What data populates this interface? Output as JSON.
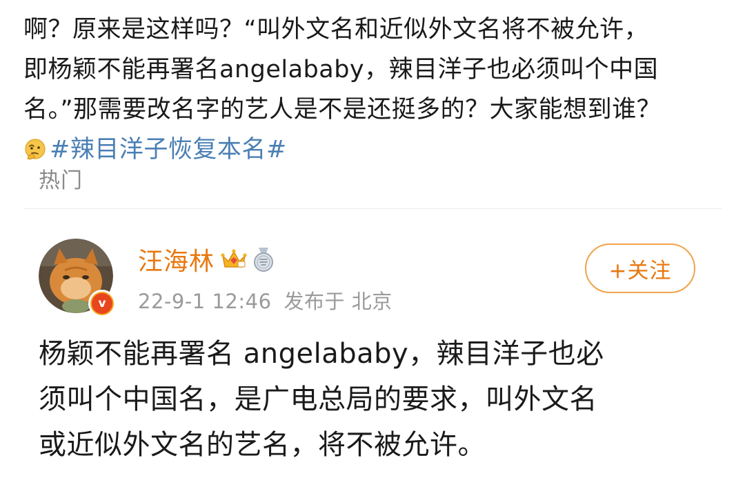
{
  "post": {
    "lines": [
      "啊？原来是这样吗？“叫外文名和近似外文名将不被允许，",
      "即杨颖不能再署名angelababy，辣目洋子也必须叫个中国",
      "名。”那需要改名字的艺人是不是还挺多的？大家能想到谁？"
    ],
    "emoji": "thinking-face-icon",
    "hashtag": "#辣目洋子恢复本名#"
  },
  "section_label": "热门",
  "comment": {
    "username": "汪海林",
    "badges": [
      "crown-icon",
      "medal-icon"
    ],
    "verified_label": "v",
    "timestamp": "22-9-1 12:46",
    "location_label": "发布于 北京",
    "follow_label": "+关注",
    "body_lines": [
      "杨颖不能再署名 angelababy，辣目洋子也必",
      "须叫个中国名，是广电总局的要求，叫外文名",
      "或近似外文名的艺名，将不被允许。"
    ]
  },
  "colors": {
    "accent_orange": "#e8780f",
    "hashtag_blue": "#4a7fb3",
    "meta_gray": "#9a9a9a",
    "verified_orange": "#f5a623"
  }
}
